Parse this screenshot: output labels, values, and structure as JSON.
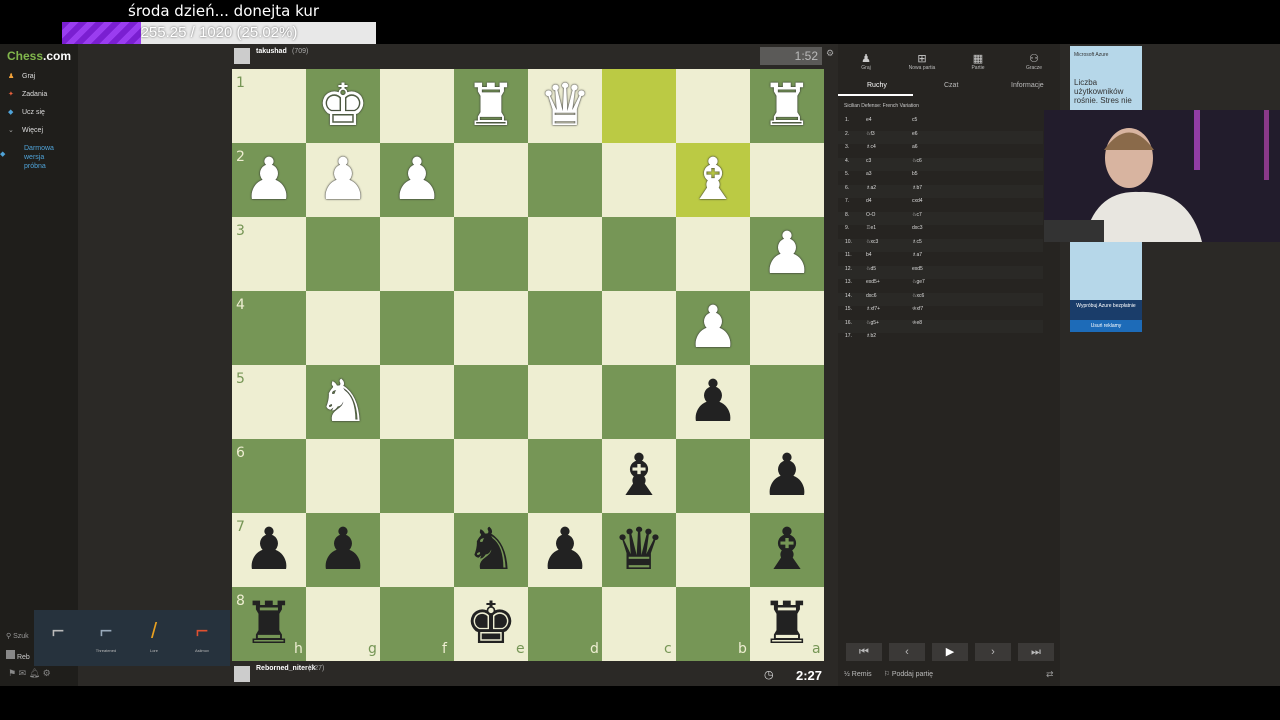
{
  "overlay": {
    "title": "środa dzień... donejta kur",
    "goal_text": "255.25 / 1020 (25.02%)",
    "goal_progress": 0.2502
  },
  "sidebar": {
    "logo": "Chess",
    "logo_suffix": ".com",
    "items": [
      {
        "label": "Graj",
        "icon": "pawn-icon"
      },
      {
        "label": "Zadania",
        "icon": "puzzle-icon"
      },
      {
        "label": "Ucz się",
        "icon": "graduation-icon"
      },
      {
        "label": "Więcej",
        "icon": "chevron-icon"
      }
    ],
    "trial_line1": "Darmowa",
    "trial_line2": "wersja",
    "trial_line3": "próbna",
    "search_label": "Szuk",
    "user_label": "Reb"
  },
  "players": {
    "top_name": "takushad",
    "top_rating": "(709)",
    "top_clock": "1:52",
    "bottom_name": "Reborned_niterek",
    "bottom_rating": "(727)",
    "bottom_clock": "2:27"
  },
  "board": {
    "ranks": [
      "1",
      "2",
      "3",
      "4",
      "5",
      "6",
      "7",
      "8"
    ],
    "files": [
      "h",
      "g",
      "f",
      "e",
      "d",
      "c",
      "b",
      "a"
    ]
  },
  "panel": {
    "top_tabs": [
      "Graj",
      "Nowa partia",
      "Partie",
      "Gracze"
    ],
    "sub_tabs": [
      "Ruchy",
      "Czat",
      "Informacje"
    ],
    "opening": "Sicilian Defense: French Variation",
    "moves": [
      {
        "n": "1.",
        "w": "e4",
        "b": "c5"
      },
      {
        "n": "2.",
        "w": "♘f3",
        "b": "e6"
      },
      {
        "n": "3.",
        "w": "♗c4",
        "b": "a6"
      },
      {
        "n": "4.",
        "w": "c3",
        "b": "♘c6"
      },
      {
        "n": "5.",
        "w": "a3",
        "b": "b5"
      },
      {
        "n": "6.",
        "w": "♗a2",
        "b": "♗b7"
      },
      {
        "n": "7.",
        "w": "d4",
        "b": "cxd4"
      },
      {
        "n": "8.",
        "w": "O-O",
        "b": "♘c7"
      },
      {
        "n": "9.",
        "w": "♖e1",
        "b": "dxc3"
      },
      {
        "n": "10.",
        "w": "♘xc3",
        "b": "♗c5"
      },
      {
        "n": "11.",
        "w": "b4",
        "b": "♗a7"
      },
      {
        "n": "12.",
        "w": "♘d5",
        "b": "exd5"
      },
      {
        "n": "13.",
        "w": "exd5+",
        "b": "♘ge7"
      },
      {
        "n": "14.",
        "w": "dxc6",
        "b": "♘xc6"
      },
      {
        "n": "15.",
        "w": "♗xf7+",
        "b": "♔xf7"
      },
      {
        "n": "16.",
        "w": "♘g5+",
        "b": "♔e8"
      },
      {
        "n": "17.",
        "w": "♗b2",
        "b": ""
      }
    ],
    "draw_label": "Remis",
    "resign_label": "Poddaj partię"
  },
  "ad": {
    "brand": "Microsoft Azure",
    "text": "Liczba użytkowników rośnie. Stres nie",
    "cta": "Wypróbuj Azure bezpłatnie",
    "remove": "Usuń reklamy"
  },
  "skins": [
    "",
    "Threatened",
    "Lore",
    "Asiimov"
  ],
  "colors": {
    "light": "#eeeed2",
    "dark": "#769656",
    "highlight": "#bbca44"
  }
}
